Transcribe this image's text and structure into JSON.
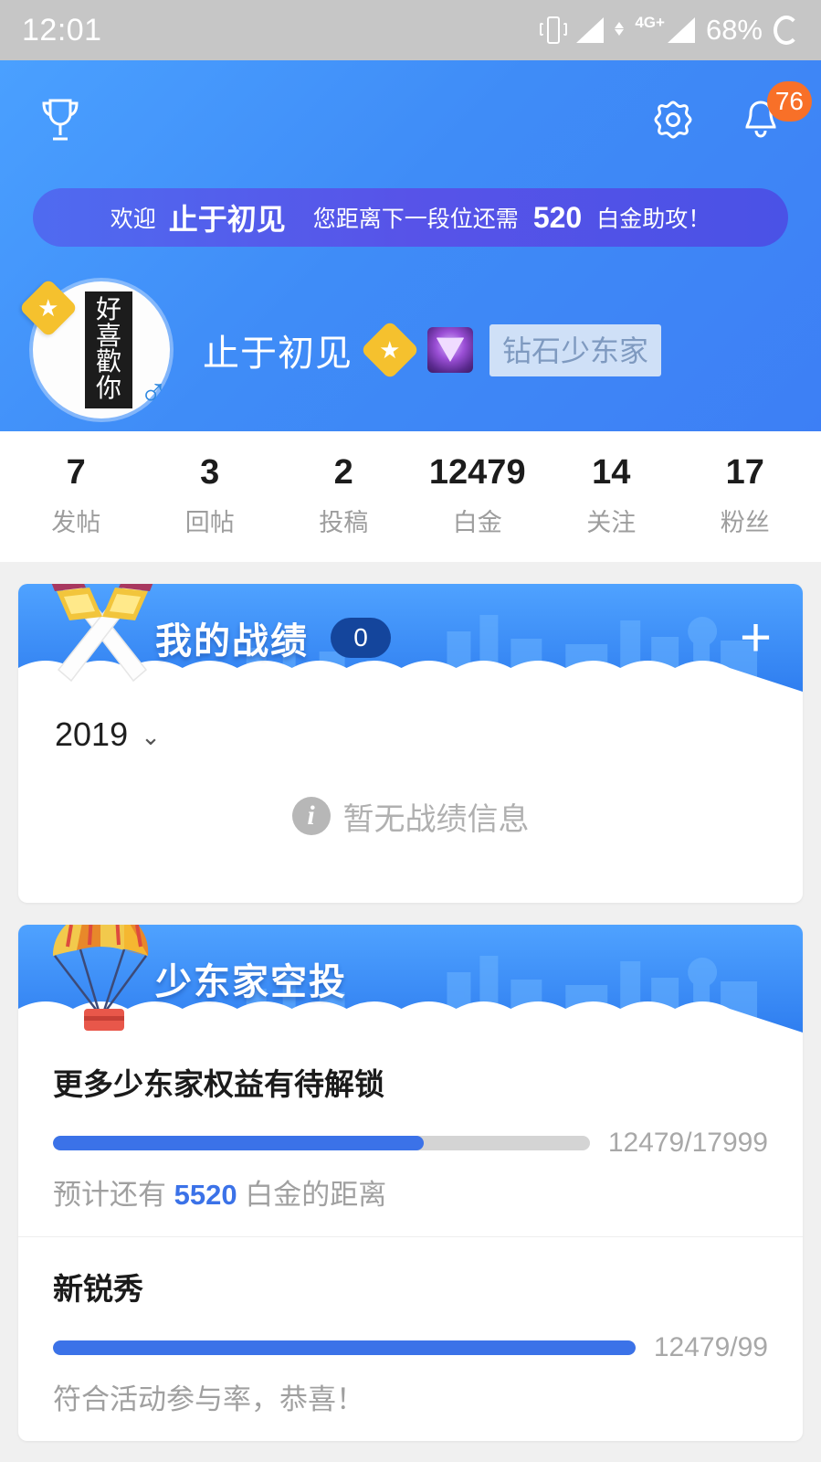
{
  "status_bar": {
    "time": "12:01",
    "battery": "68%",
    "network": "4G+",
    "icons": [
      "vibrate-icon",
      "signal-icon",
      "network-type-icon",
      "battery-circle-icon"
    ]
  },
  "header": {
    "trophy_icon": "trophy-icon",
    "settings_icon": "gear-icon",
    "notification_icon": "bell-icon",
    "notification_count": "76",
    "welcome": {
      "prefix": "欢迎",
      "username": "止于初见",
      "middle": "您距离下一段位还需",
      "amount": "520",
      "suffix": "白金助攻！"
    },
    "profile": {
      "avatar_text": [
        "好",
        "喜",
        "歡",
        "你"
      ],
      "avatar_star_icon": "star-badge-icon",
      "gender_icon": "♂",
      "username": "止于初见",
      "medal_icon": "gold-medal-icon",
      "gem_icon": "diamond-gem-icon",
      "rank_label": "钻石少东家"
    }
  },
  "stats": [
    {
      "value": "7",
      "label": "发帖"
    },
    {
      "value": "3",
      "label": "回帖"
    },
    {
      "value": "2",
      "label": "投稿"
    },
    {
      "value": "12479",
      "label": "白金"
    },
    {
      "value": "14",
      "label": "关注"
    },
    {
      "value": "17",
      "label": "粉丝"
    }
  ],
  "record_card": {
    "banner_icon": "crossed-swords-icon",
    "title": "我的战绩",
    "badge": "0",
    "add_label": "+",
    "year": "2019",
    "year_chevron": "chevron-down-icon",
    "empty_icon": "info-icon",
    "empty_text": "暂无战绩信息"
  },
  "airdrop_card": {
    "banner_icon": "parachute-icon",
    "title": "少东家空投",
    "items": [
      {
        "title": "更多少东家权益有待解锁",
        "count": "12479/17999",
        "percent": 69,
        "sub_prefix": "预计还有",
        "sub_value": "5520",
        "sub_suffix": "白金的距离"
      },
      {
        "title": "新锐秀",
        "count": "12479/99",
        "percent": 100,
        "sub_prefix": "符合活动参与率，恭喜！",
        "sub_value": "",
        "sub_suffix": ""
      }
    ]
  },
  "colors": {
    "header_blue": "#3f8cf7",
    "accent_blue": "#3b72e8",
    "badge_orange": "#f87028",
    "banner_purple": "#5753e8",
    "statusbar_gray": "#c6c6c6"
  }
}
